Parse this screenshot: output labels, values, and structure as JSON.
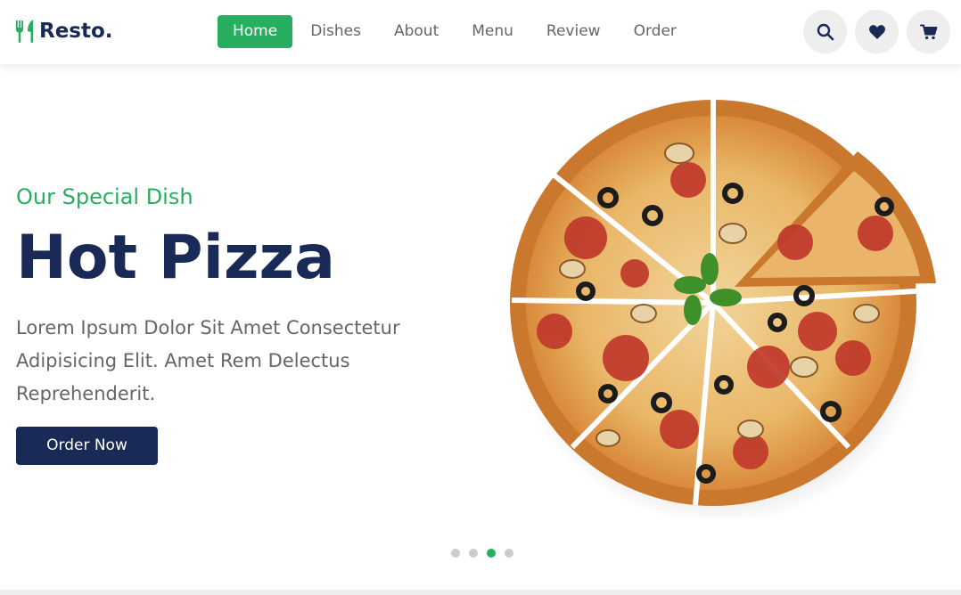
{
  "header": {
    "logo_text": "Resto.",
    "nav": [
      {
        "label": "Home",
        "active": true
      },
      {
        "label": "Dishes",
        "active": false
      },
      {
        "label": "About",
        "active": false
      },
      {
        "label": "Menu",
        "active": false
      },
      {
        "label": "Review",
        "active": false
      },
      {
        "label": "Order",
        "active": false
      }
    ],
    "icons": [
      "search-icon",
      "heart-icon",
      "cart-icon"
    ]
  },
  "hero": {
    "subtitle": "Our Special Dish",
    "title": "Hot Pizza",
    "description": "Lorem Ipsum Dolor Sit Amet Consectetur Adipisicing Elit. Amet Rem Delectus Reprehenderit.",
    "button_label": "Order Now",
    "image": "pizza-image",
    "slides": 4,
    "active_slide": 3
  },
  "colors": {
    "accent": "#27ae60",
    "brand": "#192a56",
    "text": "#666666",
    "icon_bg": "#eeeeee"
  }
}
